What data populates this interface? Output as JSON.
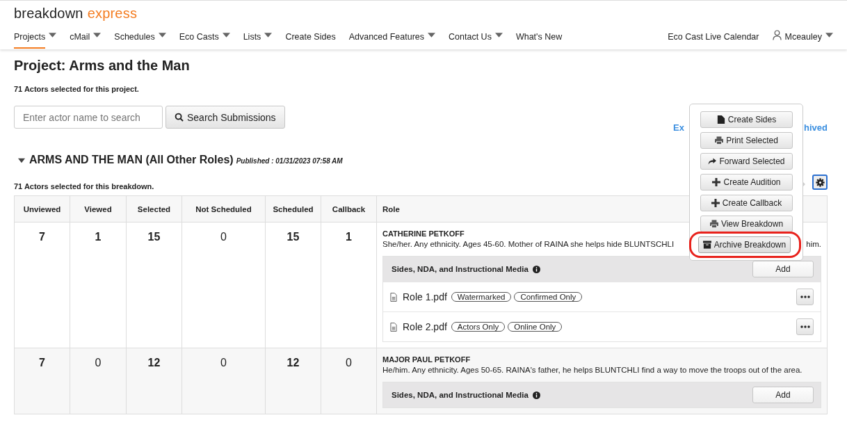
{
  "logo": [
    "breakdown",
    "express"
  ],
  "nav": [
    {
      "label": "Projects",
      "dropdown": true,
      "selected": true
    },
    {
      "label": "cMail",
      "dropdown": true,
      "selected": false
    },
    {
      "label": "Schedules",
      "dropdown": true,
      "selected": false
    },
    {
      "label": "Eco Casts",
      "dropdown": true,
      "selected": false
    },
    {
      "label": "Lists",
      "dropdown": true,
      "selected": false
    },
    {
      "label": "Create Sides",
      "dropdown": false,
      "selected": false
    },
    {
      "label": "Advanced Features",
      "dropdown": true,
      "selected": false
    },
    {
      "label": "Contact Us",
      "dropdown": true,
      "selected": false
    },
    {
      "label": "What's New",
      "dropdown": false,
      "selected": false
    }
  ],
  "nav_right": {
    "calendar": "Eco Cast Live Calendar",
    "user": "Mceauley"
  },
  "title": "Project: Arms and the Man",
  "project_count": "71 Actors selected for this project.",
  "search": {
    "placeholder": "Enter actor name to search",
    "button": "Search Submissions"
  },
  "links_partial": [
    "Ex",
    "hived"
  ],
  "breakdown": {
    "title": "ARMS AND THE MAN (All Other Roles)",
    "published": "Published : 01/31/2023 07:58 AM",
    "expanded": true,
    "count": "71 Actors selected for this breakdown."
  },
  "menu": {
    "items": [
      {
        "label": "Create Sides",
        "kind": "file",
        "highlighted": false
      },
      {
        "label": "Print Selected",
        "kind": "print",
        "highlighted": false
      },
      {
        "label": "Forward Selected",
        "kind": "forward",
        "highlighted": false
      },
      {
        "label": "Create Audition",
        "kind": "plus",
        "highlighted": false
      },
      {
        "label": "Create Callback",
        "kind": "plus",
        "highlighted": false
      },
      {
        "label": "View Breakdown",
        "kind": "print",
        "highlighted": false
      },
      {
        "label": "Archive Breakdown",
        "kind": "archive",
        "highlighted": true
      }
    ]
  },
  "table": {
    "columns": [
      "Unviewed",
      "Viewed",
      "Selected",
      "Not Scheduled",
      "Scheduled",
      "Callback",
      "Role"
    ],
    "rows": [
      {
        "counts": [
          {
            "value": "7",
            "bold": true
          },
          {
            "value": "1",
            "bold": true
          },
          {
            "value": "15",
            "bold": true
          },
          {
            "value": "0",
            "bold": false
          },
          {
            "value": "15",
            "bold": true
          },
          {
            "value": "1",
            "bold": true
          }
        ],
        "role": {
          "name": "CATHERINE PETKOFF",
          "description": [
            "She/her. Any ethnicity. Ages 45-60. Mother of RAINA she helps hide BLUNTSCHLI",
            "him."
          ]
        },
        "media": {
          "title": "Sides, NDA, and Instructional Media",
          "add": "Add",
          "files": [
            {
              "name": "Role 1.pdf",
              "tags": [
                "Watermarked",
                "Confirmed Only"
              ]
            },
            {
              "name": "Role 2.pdf",
              "tags": [
                "Actors Only",
                "Online Only"
              ]
            }
          ]
        }
      },
      {
        "counts": [
          {
            "value": "7",
            "bold": true
          },
          {
            "value": "0",
            "bold": false
          },
          {
            "value": "12",
            "bold": true
          },
          {
            "value": "0",
            "bold": false
          },
          {
            "value": "12",
            "bold": true
          },
          {
            "value": "0",
            "bold": false
          }
        ],
        "role": {
          "name": "MAJOR PAUL PETKOFF",
          "description": [
            "He/him. Any ethnicity. Ages 50-65. RAINA's father, he helps BLUNTCHLI find a way to move the troops out of the area."
          ]
        },
        "media": {
          "title": "Sides, NDA, and Instructional Media",
          "add": "Add"
        }
      }
    ]
  }
}
